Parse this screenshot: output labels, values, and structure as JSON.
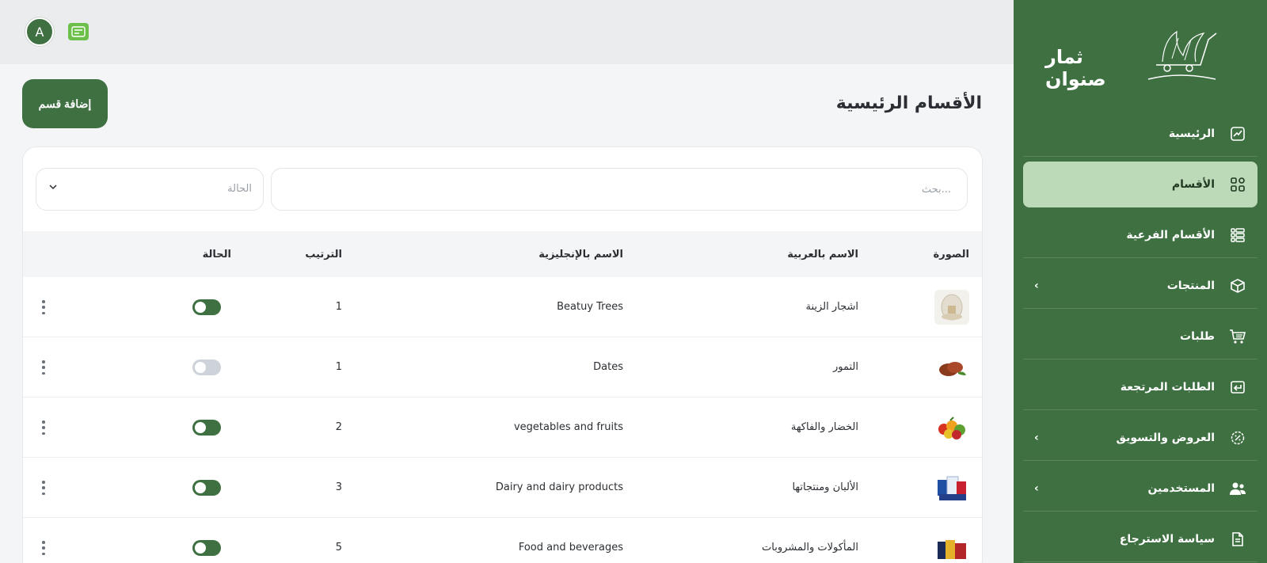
{
  "brand": {
    "name": "ثمار صنوان"
  },
  "colors": {
    "primary": "#3f7042",
    "active_bg": "#bcd9b8",
    "accent_green": "#6cc04a"
  },
  "topbar": {
    "avatar_letter": "A",
    "lang_icon": "translate-icon"
  },
  "sidebar": {
    "items": [
      {
        "label": "الرئيسية",
        "icon": "chart-icon",
        "active": false,
        "has_submenu": false
      },
      {
        "label": "الأقسام",
        "icon": "grid-icon",
        "active": true,
        "has_submenu": false
      },
      {
        "label": "الأقسام الفرعية",
        "icon": "list-grid-icon",
        "active": false,
        "has_submenu": false
      },
      {
        "label": "المنتجات",
        "icon": "box-icon",
        "active": false,
        "has_submenu": true
      },
      {
        "label": "طلبات",
        "icon": "cart-icon",
        "active": false,
        "has_submenu": false
      },
      {
        "label": "الطلبات المرتجعة",
        "icon": "return-icon",
        "active": false,
        "has_submenu": false
      },
      {
        "label": "العروض والتسويق",
        "icon": "discount-icon",
        "active": false,
        "has_submenu": true
      },
      {
        "label": "المستخدمين",
        "icon": "users-icon",
        "active": false,
        "has_submenu": true
      },
      {
        "label": "سياسة الاسترجاع",
        "icon": "document-icon",
        "active": false,
        "has_submenu": false
      }
    ],
    "chevron": "‹"
  },
  "main": {
    "title": "الأقسام الرئيسية",
    "add_button": "إضافة قسم",
    "search_placeholder": "بحث...",
    "status_filter": "الحالة"
  },
  "table": {
    "headers": {
      "image": "الصورة",
      "name_ar": "الاسم بالعربية",
      "name_en": "الاسم بالإنجليزية",
      "order": "الترتيب",
      "status": "الحالة"
    },
    "rows": [
      {
        "name_ar": "اشجار الزينة",
        "name_en": "Beatuy Trees",
        "order": "1",
        "active": true,
        "thumb": "jar"
      },
      {
        "name_ar": "التمور",
        "name_en": "Dates",
        "order": "1",
        "active": false,
        "thumb": "dates"
      },
      {
        "name_ar": "الخضار والفاكهة",
        "name_en": "vegetables and fruits",
        "order": "2",
        "active": true,
        "thumb": "veg"
      },
      {
        "name_ar": "الألبان ومنتجاتها",
        "name_en": "Dairy and dairy products",
        "order": "3",
        "active": true,
        "thumb": "dairy"
      },
      {
        "name_ar": "المأكولات والمشروبات",
        "name_en": "Food and beverages",
        "order": "5",
        "active": true,
        "thumb": "food"
      }
    ]
  }
}
